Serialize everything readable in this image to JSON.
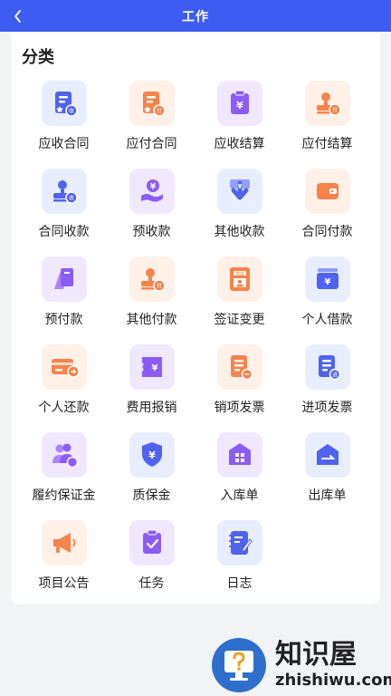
{
  "header": {
    "title": "工作"
  },
  "section": {
    "title": "分类"
  },
  "colors": {
    "header_bg": "#3d5cf2",
    "blue": "#4f63ee",
    "orange": "#f5834a",
    "purple": "#8b5cf6"
  },
  "items": [
    {
      "label": "应收合同",
      "icon": "contract-receivable-icon",
      "tone": "blue"
    },
    {
      "label": "应付合同",
      "icon": "contract-payable-icon",
      "tone": "orange"
    },
    {
      "label": "应收结算",
      "icon": "settlement-receivable-icon",
      "tone": "purple"
    },
    {
      "label": "应付结算",
      "icon": "settlement-payable-icon",
      "tone": "orange"
    },
    {
      "label": "合同收款",
      "icon": "contract-collection-icon",
      "tone": "blue"
    },
    {
      "label": "预收款",
      "icon": "advance-receipt-icon",
      "tone": "purple"
    },
    {
      "label": "其他收款",
      "icon": "other-receipt-icon",
      "tone": "blue"
    },
    {
      "label": "合同付款",
      "icon": "contract-payment-wallet-icon",
      "tone": "orange"
    },
    {
      "label": "预付款",
      "icon": "advance-payment-icon",
      "tone": "purple"
    },
    {
      "label": "其他付款",
      "icon": "other-payment-icon",
      "tone": "orange"
    },
    {
      "label": "签证变更",
      "icon": "visa-change-icon",
      "tone": "orange"
    },
    {
      "label": "个人借款",
      "icon": "personal-loan-icon",
      "tone": "blue"
    },
    {
      "label": "个人还款",
      "icon": "personal-repayment-card-icon",
      "tone": "orange"
    },
    {
      "label": "费用报销",
      "icon": "expense-reimbursement-icon",
      "tone": "purple"
    },
    {
      "label": "销项发票",
      "icon": "output-invoice-icon",
      "tone": "orange"
    },
    {
      "label": "进项发票",
      "icon": "input-invoice-icon",
      "tone": "blue"
    },
    {
      "label": "履约保证金",
      "icon": "performance-bond-icon",
      "tone": "purple"
    },
    {
      "label": "质保金",
      "icon": "warranty-shield-icon",
      "tone": "blue"
    },
    {
      "label": "入库单",
      "icon": "warehouse-in-icon",
      "tone": "purple"
    },
    {
      "label": "出库单",
      "icon": "warehouse-out-icon",
      "tone": "blue"
    },
    {
      "label": "项目公告",
      "icon": "megaphone-icon",
      "tone": "orange"
    },
    {
      "label": "任务",
      "icon": "task-clipboard-icon",
      "tone": "purple"
    },
    {
      "label": "日志",
      "icon": "journal-icon",
      "tone": "blue"
    }
  ],
  "watermark": {
    "name": "知识屋",
    "url": "zhishiwu.com"
  }
}
